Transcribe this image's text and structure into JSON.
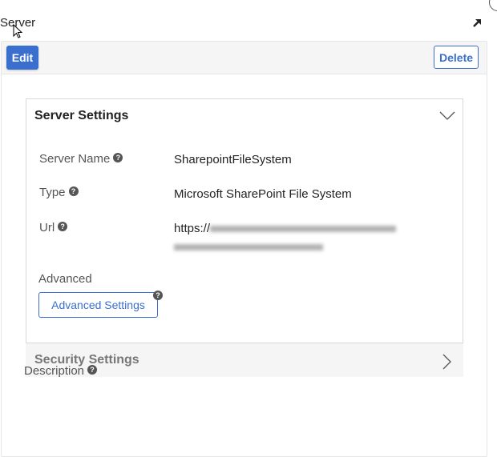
{
  "panel": {
    "title": "Server",
    "expand_icon": "arrow-up-right-icon"
  },
  "toolbar": {
    "edit_label": "Edit",
    "delete_label": "Delete"
  },
  "server_settings": {
    "title": "Server Settings",
    "toggle_icon": "chevron-down-icon",
    "fields": [
      {
        "label": "Server Name",
        "value": "SharepointFileSystem",
        "help_icon": "question-circle-icon"
      },
      {
        "label": "Type",
        "value": "Microsoft SharePoint File System",
        "help_icon": "question-circle-icon"
      },
      {
        "label": "Url",
        "value": "https://",
        "value_redacted": true,
        "help_icon": "question-circle-icon"
      }
    ],
    "advanced_label": "Advanced",
    "advanced_button_label": "Advanced Settings"
  },
  "security_settings": {
    "title": "Security Settings",
    "toggle_icon": "chevron-right-icon"
  },
  "description": {
    "label": "Description"
  },
  "colors": {
    "accent": "#3a6fcf",
    "toolbar_bg": "#f5f5f5"
  }
}
